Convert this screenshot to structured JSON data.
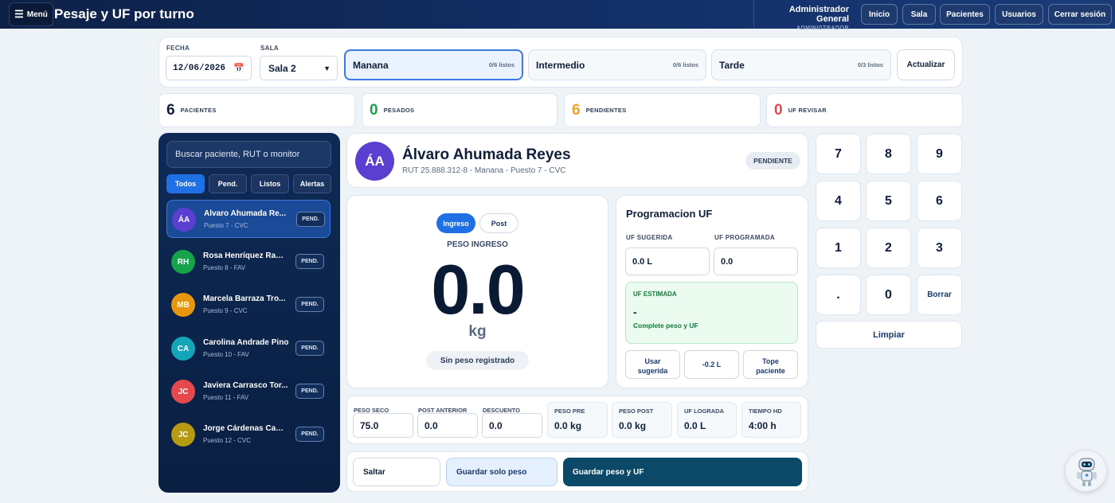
{
  "header": {
    "menu_label": "Menú",
    "title": "Pesaje y UF por turno",
    "user_name": "Administrador General",
    "user_role": "ADMINISTRADOR",
    "nav": [
      "Inicio",
      "Sala",
      "Pacientes",
      "Usuarios",
      "Cerrar sesión"
    ]
  },
  "controls": {
    "fecha_label": "FECHA",
    "fecha_value": "12/06/2026",
    "sala_label": "SALA",
    "sala_value": "Sala 2",
    "shifts": [
      {
        "name": "Manana",
        "count": "0/6 listos"
      },
      {
        "name": "Intermedio",
        "count": "0/6 listos"
      },
      {
        "name": "Tarde",
        "count": "0/3 listos"
      }
    ],
    "refresh_label": "Actualizar"
  },
  "stats": [
    {
      "value": "6",
      "label": "PACIENTES",
      "color": "#0f1f3a"
    },
    {
      "value": "0",
      "label": "PESADOS",
      "color": "#16a34a"
    },
    {
      "value": "6",
      "label": "PENDIENTES",
      "color": "#f0a020"
    },
    {
      "value": "0",
      "label": "UF REVISAR",
      "color": "#e5484d"
    }
  ],
  "sidebar": {
    "search_placeholder": "Buscar paciente, RUT o monitor",
    "filters": [
      "Todos",
      "Pend.",
      "Listos",
      "Alertas"
    ],
    "patients": [
      {
        "initials": "ÁA",
        "name": "Álvaro Ahumada Re...",
        "sub": "Puesto 7 - CVC",
        "badge": "PEND.",
        "color": "#5b3fd1"
      },
      {
        "initials": "RH",
        "name": "Rosa Henríquez Ram...",
        "sub": "Puesto 8 - FAV",
        "badge": "PEND.",
        "color": "#16a34a"
      },
      {
        "initials": "MB",
        "name": "Marcela Barraza Tro...",
        "sub": "Puesto 9 - CVC",
        "badge": "PEND.",
        "color": "#e8950f"
      },
      {
        "initials": "CA",
        "name": "Carolina Andrade Pino",
        "sub": "Puesto 10 - FAV",
        "badge": "PEND.",
        "color": "#14a5b8"
      },
      {
        "initials": "JC",
        "name": "Javiera Carrasco Tor...",
        "sub": "Puesto 11 - FAV",
        "badge": "PEND.",
        "color": "#e5484d"
      },
      {
        "initials": "JC",
        "name": "Jorge Cárdenas Cam...",
        "sub": "Puesto 12 - CVC",
        "badge": "PEND.",
        "color": "#b59a12"
      }
    ]
  },
  "patient": {
    "initials": "ÁA",
    "name": "Álvaro Ahumada Reyes",
    "details": "RUT 25.888.312-8 - Manana - Puesto 7 - CVC",
    "status": "PENDIENTE"
  },
  "weight": {
    "toggle_in": "Ingreso",
    "toggle_post": "Post",
    "label": "PESO INGRESO",
    "value": "0.0",
    "unit": "kg",
    "status": "Sin peso registrado"
  },
  "uf": {
    "title": "Programacion UF",
    "sugerida_label": "UF SUGERIDA",
    "sugerida_value": "0.0 L",
    "programada_label": "UF PROGRAMADA",
    "programada_value": "0.0",
    "estimada_label": "UF ESTIMADA",
    "estimada_value": "-",
    "estimada_note": "Complete peso y UF",
    "btn_usar_1": "Usar",
    "btn_usar_2": "sugerida",
    "btn_minus": "-0.2 L",
    "btn_tope_1": "Tope",
    "btn_tope_2": "paciente"
  },
  "keypad": {
    "keys": [
      "7",
      "8",
      "9",
      "4",
      "5",
      "6",
      "1",
      "2",
      "3",
      ".",
      "0",
      "Borrar"
    ],
    "clear_label": "Limpiar"
  },
  "metrics": {
    "peso_seco_label": "PESO SECO",
    "peso_seco_value": "75.0",
    "post_anterior_label": "POST ANTERIOR",
    "post_anterior_value": "0.0",
    "descuento_label": "DESCUENTO",
    "descuento_value": "0.0",
    "peso_pre_label": "PESO PRE",
    "peso_pre_value": "0.0 kg",
    "peso_post_label": "PESO POST",
    "peso_post_value": "0.0 kg",
    "uf_lograda_label": "UF LOGRADA",
    "uf_lograda_value": "0.0 L",
    "tiempo_hd_label": "TIEMPO HD",
    "tiempo_hd_value": "4:00 h"
  },
  "actions": {
    "skip": "Saltar",
    "save_weight": "Guardar solo peso",
    "save_all": "Guardar peso y UF"
  }
}
